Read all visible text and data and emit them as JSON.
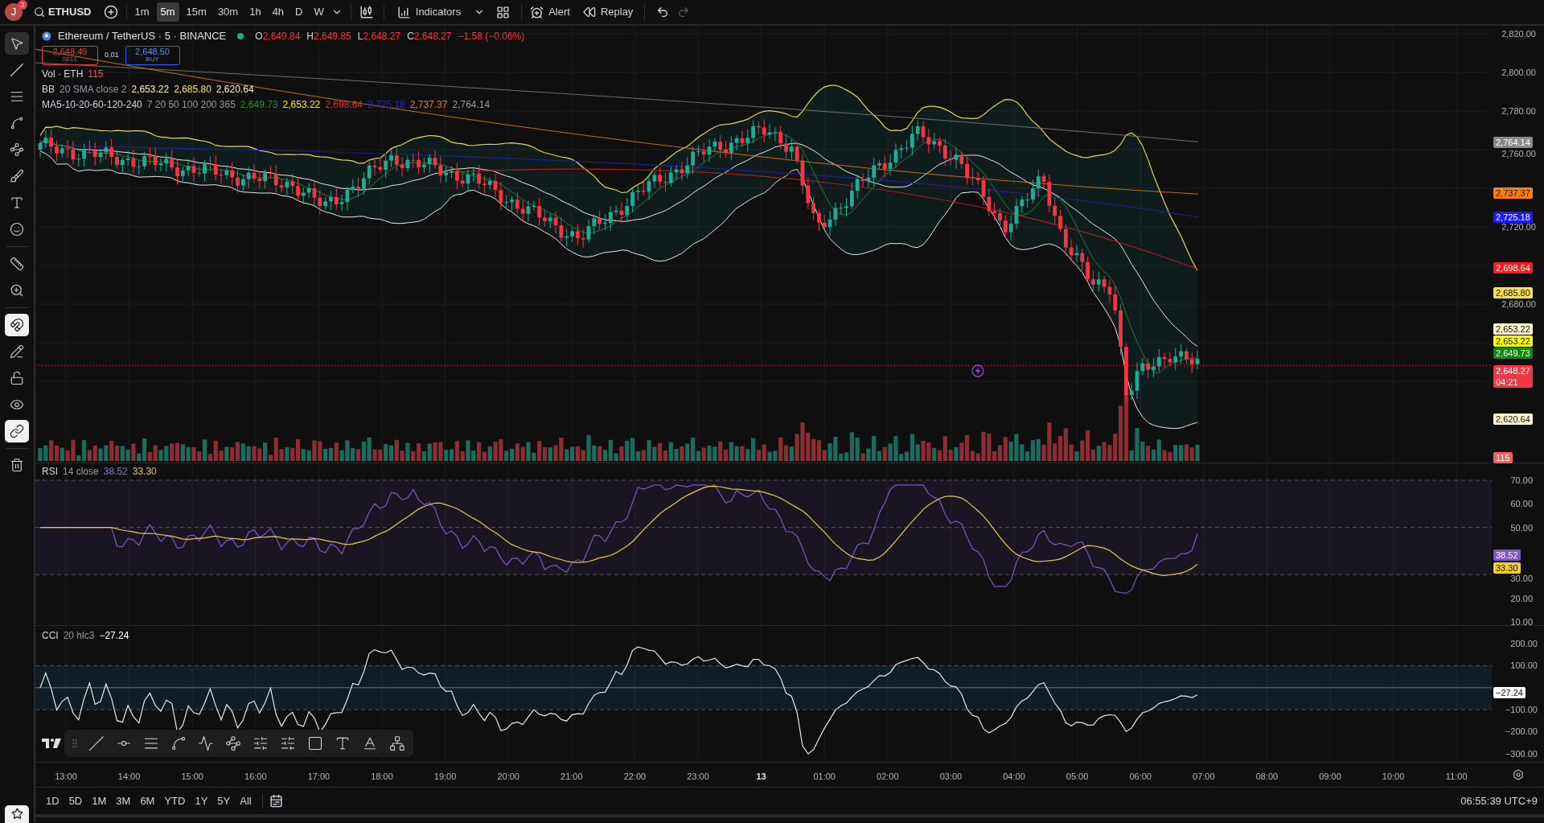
{
  "top_bar": {
    "avatar": "J",
    "notifications": "3",
    "symbol": "ETHUSD",
    "intervals": [
      {
        "label": "1m",
        "selected": false
      },
      {
        "label": "5m",
        "selected": true
      },
      {
        "label": "15m",
        "selected": false
      },
      {
        "label": "30m",
        "selected": false
      },
      {
        "label": "1h",
        "selected": false
      },
      {
        "label": "4h",
        "selected": false
      },
      {
        "label": "D",
        "selected": false
      },
      {
        "label": "W",
        "selected": false
      }
    ],
    "indicators": "Indicators",
    "alert": "Alert",
    "replay": "Replay",
    "redo_disabled": true
  },
  "left_toolbar": {
    "tools": [
      {
        "selected": true
      },
      {
        "selected": false
      },
      {
        "selected": false
      },
      {
        "selected": false
      },
      {
        "selected": false
      },
      {
        "selected": false
      },
      {
        "selected": false
      },
      {
        "selected": false
      },
      {
        "selected": false
      },
      {
        "selected": false
      }
    ],
    "toggles": [
      {
        "on": true
      },
      {
        "on": false
      },
      {
        "on": false
      },
      {
        "on": false
      },
      {
        "on": true
      }
    ]
  },
  "legend": {
    "title": "Ethereum / TetherUS · 5 · BINANCE",
    "market_open": true,
    "ohlc": [
      {
        "label": "O",
        "value": "2,649.84"
      },
      {
        "label": "H",
        "value": "2,649.85"
      },
      {
        "label": "L",
        "value": "2,648.27"
      },
      {
        "label": "C",
        "value": "2,648.27"
      }
    ],
    "change": "−1.58 (−0.06%)",
    "sell": {
      "price": "2,648.49",
      "label": "SELL"
    },
    "spread": "0.01",
    "buy": {
      "price": "2,648.50",
      "label": "BUY"
    }
  },
  "indicators": [
    {
      "name": "Vol · ETH",
      "values": [
        {
          "text": "115",
          "color": "#f7525f"
        }
      ]
    },
    {
      "name": "BB",
      "params": "20 SMA close 2",
      "values": [
        {
          "text": "2,653.22",
          "color": "#f5f0c0"
        },
        {
          "text": "2,685.80",
          "color": "#f5e050"
        },
        {
          "text": "2,620.64",
          "color": "#f5f0c0"
        }
      ]
    },
    {
      "name": "MA5-10-20-60-120-240",
      "params": "7 20 50 100 200 365",
      "values": [
        {
          "text": "2,649.73",
          "color": "#1a9a1a"
        },
        {
          "text": "2,653.22",
          "color": "#f0f000"
        },
        {
          "text": "2,698.64",
          "color": "#f22020"
        },
        {
          "text": "2,725.18",
          "color": "#2020f0"
        },
        {
          "text": "2,737.37",
          "color": "#f07a10"
        },
        {
          "text": "2,764.14",
          "color": "#9a9a9a"
        }
      ]
    }
  ],
  "price_axis": {
    "labels": [
      "2,820.00",
      "2,800.00",
      "2,780.00",
      "2,760.00",
      "2,720.00",
      "2,680.00"
    ],
    "tags": [
      {
        "text": "2,764.14",
        "color": "#8a8a8a"
      },
      {
        "text": "2,737.37",
        "color": "#ff8000"
      },
      {
        "text": "2,725.18",
        "color": "#1a1aff"
      },
      {
        "text": "2,698.64",
        "color": "#ff1a1a"
      },
      {
        "text": "2,685.80",
        "color": "#f5e050"
      },
      {
        "text": "2,653.22",
        "color": "#fff6cc"
      },
      {
        "text": "2,653.22",
        "color": "#ffff00"
      },
      {
        "text": "2,649.73",
        "color": "#0a8a0a"
      },
      {
        "text": "2,648.27",
        "countdown": "04:21",
        "color": "#f23645"
      },
      {
        "text": "2,620.64",
        "color": "#fff6cc"
      },
      {
        "text": "115",
        "color": "#f06060"
      }
    ]
  },
  "rsi": {
    "name": "RSI",
    "params": "14 close",
    "values": [
      {
        "text": "38.52",
        "color": "#8e6fd6"
      },
      {
        "text": "33.30",
        "color": "#e8c547"
      }
    ],
    "axis": [
      "70.00",
      "60.00",
      "50.00",
      "30.00",
      "20.00",
      "10.00"
    ],
    "tags": [
      {
        "text": "38.52",
        "color": "#7e57c2"
      },
      {
        "text": "33.30",
        "color": "#f5d020"
      }
    ]
  },
  "cci": {
    "name": "CCI",
    "params": "20 hlc3",
    "values": [
      {
        "text": "−27.24",
        "color": "#ffffff"
      }
    ],
    "axis": [
      "200.00",
      "100.00",
      "−100.00",
      "−200.00",
      "−300.00"
    ],
    "tags": [
      {
        "text": "−27.24",
        "color": "#ffffff"
      }
    ]
  },
  "time_axis": [
    {
      "label": "13:00",
      "day_start": false
    },
    {
      "label": "14:00",
      "day_start": false
    },
    {
      "label": "15:00",
      "day_start": false
    },
    {
      "label": "16:00",
      "day_start": false
    },
    {
      "label": "17:00",
      "day_start": false
    },
    {
      "label": "18:00",
      "day_start": false
    },
    {
      "label": "19:00",
      "day_start": false
    },
    {
      "label": "20:00",
      "day_start": false
    },
    {
      "label": "21:00",
      "day_start": false
    },
    {
      "label": "22:00",
      "day_start": false
    },
    {
      "label": "23:00",
      "day_start": false
    },
    {
      "label": "13",
      "day_start": true
    },
    {
      "label": "01:00",
      "day_start": false
    },
    {
      "label": "02:00",
      "day_start": false
    },
    {
      "label": "03:00",
      "day_start": false
    },
    {
      "label": "04:00",
      "day_start": false
    },
    {
      "label": "05:00",
      "day_start": false
    },
    {
      "label": "06:00",
      "day_start": false
    },
    {
      "label": "07:00",
      "day_start": false
    },
    {
      "label": "08:00",
      "day_start": false
    },
    {
      "label": "09:00",
      "day_start": false
    },
    {
      "label": "10:00",
      "day_start": false
    },
    {
      "label": "11:00",
      "day_start": false
    }
  ],
  "bottom_bar": {
    "ranges": [
      "1D",
      "5D",
      "1M",
      "3M",
      "6M",
      "YTD",
      "1Y",
      "5Y",
      "All"
    ],
    "clock": "06:55:39 UTC+9"
  }
}
